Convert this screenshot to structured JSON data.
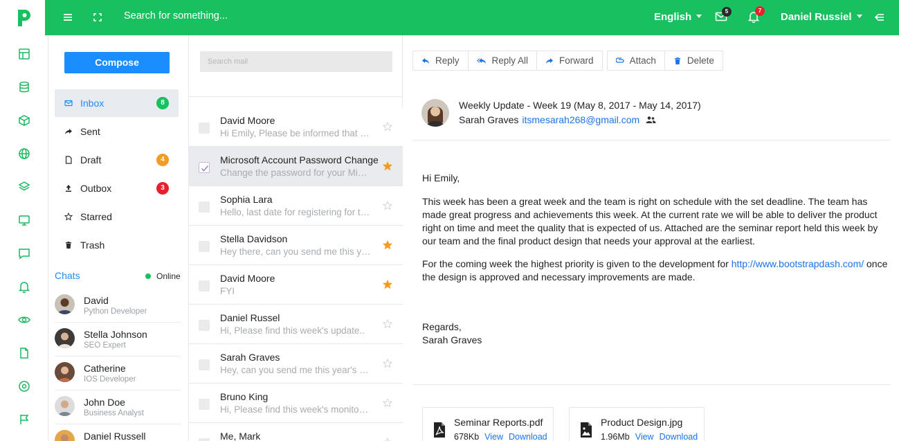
{
  "navbar": {
    "search_placeholder": "Search for something...",
    "language": "English",
    "mail_badge": "5",
    "notif_badge": "7",
    "user": "Daniel Russiel"
  },
  "sidebar": {
    "compose_label": "Compose",
    "folders": [
      {
        "label": "Inbox",
        "badge": "8",
        "badge_color": "#19c060",
        "icon": "mail-icon"
      },
      {
        "label": "Sent",
        "badge": "",
        "icon": "share-icon"
      },
      {
        "label": "Draft",
        "badge": "4",
        "badge_color": "#f59a23",
        "icon": "file-icon"
      },
      {
        "label": "Outbox",
        "badge": "3",
        "badge_color": "#e8202b",
        "icon": "upload-icon"
      },
      {
        "label": "Starred",
        "badge": "",
        "icon": "star-icon"
      },
      {
        "label": "Trash",
        "badge": "",
        "icon": "trash-icon"
      }
    ],
    "chats_title": "Chats",
    "online_label": "Online",
    "chats": [
      {
        "name": "David",
        "role": "Python Developer"
      },
      {
        "name": "Stella Johnson",
        "role": "SEO Expert"
      },
      {
        "name": "Catherine",
        "role": "IOS Developer"
      },
      {
        "name": "John Doe",
        "role": "Business Analyst"
      },
      {
        "name": "Daniel Russell",
        "role": ""
      }
    ]
  },
  "mail_list": {
    "search_placeholder": "Search mail",
    "rows": [
      {
        "sender": "David Moore",
        "preview": "Hi Emily, Please be informed that the new project presentation is due Monday.",
        "starred": false,
        "active": false
      },
      {
        "sender": "Microsoft Account Password Change",
        "preview": "Change the password for your Microsoft Account using the security code.",
        "starred": true,
        "active": true
      },
      {
        "sender": "Sophia Lara",
        "preview": "Hello, last date for registering for the annual conference is approaching.",
        "starred": false,
        "active": false
      },
      {
        "sender": "Stella Davidson",
        "preview": "Hey there, can you send me this year's marketing plan?",
        "starred": true,
        "active": false
      },
      {
        "sender": "David Moore",
        "preview": "FYI",
        "starred": true,
        "active": false
      },
      {
        "sender": "Daniel Russel",
        "preview": "Hi, Please find this week's update..",
        "starred": false,
        "active": false
      },
      {
        "sender": "Sarah Graves",
        "preview": "Hey, can you send me this year's holiday calendar?",
        "starred": false,
        "active": false
      },
      {
        "sender": "Bruno King",
        "preview": "Hi, Please find this week's monitoring report.",
        "starred": false,
        "active": false
      },
      {
        "sender": "Me, Mark",
        "preview": "",
        "starred": false,
        "active": false
      }
    ]
  },
  "toolbar": {
    "reply": "Reply",
    "reply_all": "Reply All",
    "forward": "Forward",
    "attach": "Attach",
    "delete": "Delete"
  },
  "message": {
    "subject": "Weekly Update - Week 19 (May 8, 2017 - May 14, 2017)",
    "from_name": "Sarah Graves",
    "from_email": "itsmesarah268@gmail.com",
    "greeting": "Hi Emily,",
    "para1": "This week has been a great week and the team is right on schedule with the set deadline. The team has made great progress and achievements this week. At the current rate we will be able to deliver the product right on time and meet the quality that is expected of us. Attached are the seminar report held this week by our team and the final product design that needs your approval at the earliest.",
    "para2_before": "For the coming week the highest priority is given to the development for ",
    "para2_link": "http://www.bootstrapdash.com/",
    "para2_after": " once the design is approved and necessary improvements are made.",
    "regards": "Regards,",
    "signature": "Sarah Graves"
  },
  "attachments": [
    {
      "name": "Seminar Reports.pdf",
      "size": "678Kb",
      "view": "View",
      "download": "Download"
    },
    {
      "name": "Product Design.jpg",
      "size": "1.96Mb",
      "view": "View",
      "download": "Download"
    }
  ],
  "colors": {
    "brand_green": "#19c060",
    "primary_blue": "#1a8dff",
    "star_orange": "#f59a23"
  }
}
